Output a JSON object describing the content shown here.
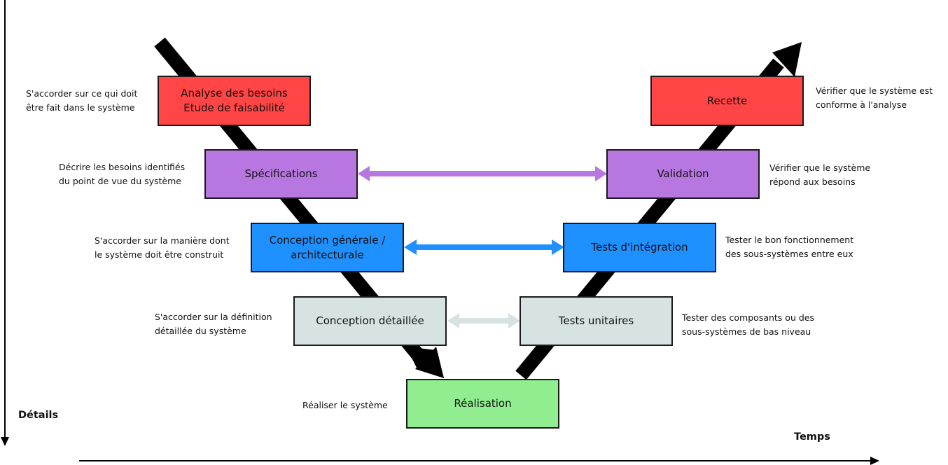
{
  "colors": {
    "red": "#ff4545",
    "purple": "#b877e0",
    "blue": "#1e90ff",
    "gray": "#d6e3e2",
    "green": "#90ee90",
    "shaft": "#000000",
    "link_purple": "#b877e0",
    "link_blue": "#1e90ff",
    "link_gray": "#d6e3e2"
  },
  "axes": {
    "vertical_label": "Détails",
    "horizontal_label": "Temps"
  },
  "left_phases": [
    {
      "label": "Analyse des besoins\nEtude de faisabilité",
      "description": "S'accorder sur ce qui doit\nêtre fait dans le système",
      "color": "red"
    },
    {
      "label": "Spécifications",
      "description": "Décrire les besoins identifiés\ndu point de vue du système",
      "color": "purple"
    },
    {
      "label": "Conception générale /\narchitecturale",
      "description": "S'accorder sur la manière dont\nle système doit être construit",
      "color": "blue"
    },
    {
      "label": "Conception détaillée",
      "description": "S'accorder sur la définition\ndétaillée du système",
      "color": "gray"
    }
  ],
  "bottom_phase": {
    "label": "Réalisation",
    "description": "Réaliser le système",
    "color": "green"
  },
  "right_phases": [
    {
      "label": "Recette",
      "description": "Vérifier que le système est\nconforme à l'analyse",
      "color": "red"
    },
    {
      "label": "Validation",
      "description": "Vérifier que le système\nrépond aux besoins",
      "color": "purple"
    },
    {
      "label": "Tests d'intégration",
      "description": "Tester le bon fonctionnement\ndes sous-systèmes entre eux",
      "color": "blue"
    },
    {
      "label": "Tests unitaires",
      "description": "Tester des composants ou des\nsous-systèmes de bas niveau",
      "color": "gray"
    }
  ],
  "links": [
    {
      "from": "Spécifications",
      "to": "Validation",
      "color": "link_purple"
    },
    {
      "from": "Conception générale / architecturale",
      "to": "Tests d'intégration",
      "color": "link_blue"
    },
    {
      "from": "Conception détaillée",
      "to": "Tests unitaires",
      "color": "link_gray"
    }
  ]
}
